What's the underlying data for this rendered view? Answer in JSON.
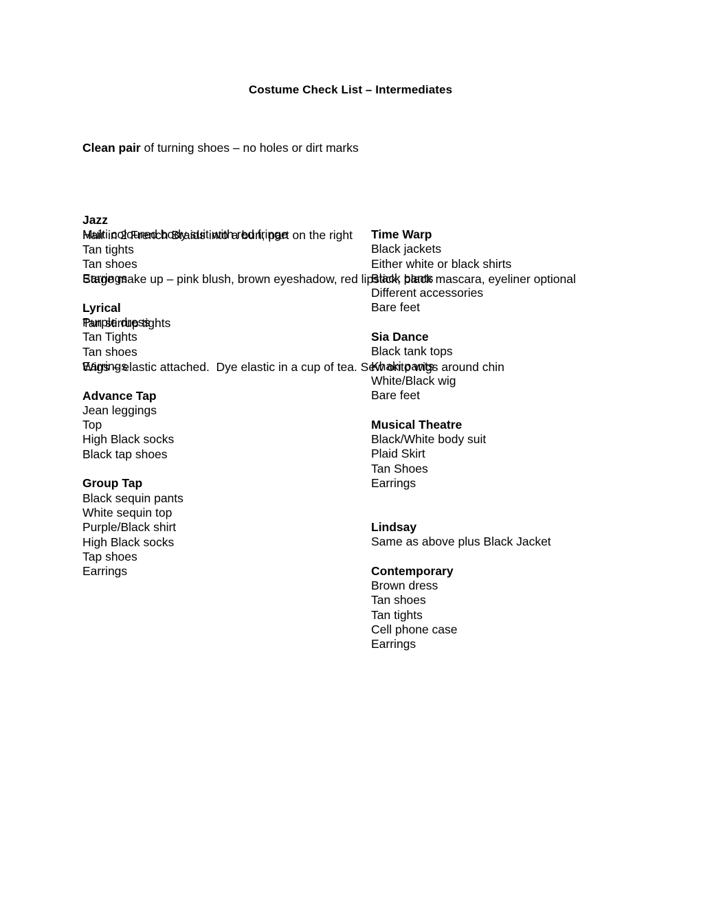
{
  "document": {
    "title": "Costume Check List – Intermediates",
    "intro": {
      "clean_pair_bold": "Clean pair",
      "clean_pair_rest": " of turning shoes – no holes or dirt marks",
      "lines": [
        "Hair in 2 French Braids into a bun, part on the right",
        "Stage make up – pink blush, brown eyeshadow, red lipstick, black mascara, eyeliner optional",
        "Tan stirrup tights",
        "Wigs – elastic attached.  Dye elastic in a cup of tea. Sew onto wigs around chin"
      ]
    },
    "left_column": [
      {
        "heading": "Jazz",
        "items": [
          "Multi coloured body suit with red fringe",
          "Tan tights",
          "Tan shoes",
          "Earrings"
        ]
      },
      {
        "heading": "Lyrical",
        "items": [
          "Purple dress",
          "Tan Tights",
          "Tan shoes",
          "Earrings"
        ]
      },
      {
        "heading": "Advance Tap",
        "items": [
          "Jean leggings",
          "Top",
          "High Black socks",
          "Black tap shoes"
        ]
      },
      {
        "heading": "Group Tap",
        "items": [
          "Black sequin pants",
          "White sequin top",
          "Purple/Black shirt",
          "High Black socks",
          "Tap shoes",
          "Earrings"
        ]
      }
    ],
    "right_column": [
      {
        "heading": "Time Warp",
        "items": [
          "Black jackets",
          "Either white or black shirts",
          "Black pants",
          "Different accessories",
          "Bare feet"
        ]
      },
      {
        "heading": "Sia Dance",
        "items": [
          "Black tank tops",
          "Khaki pants",
          "White/Black wig",
          "Bare feet"
        ]
      },
      {
        "heading": "Musical Theatre",
        "items": [
          "Black/White body suit",
          "Plaid Skirt",
          "Tan Shoes",
          "Earrings"
        ]
      },
      {
        "heading": "Lindsay",
        "extra_gap": true,
        "items": [
          "Same as above plus Black Jacket"
        ]
      },
      {
        "heading": "Contemporary",
        "items": [
          "Brown dress",
          "Tan shoes",
          "Tan tights",
          "Cell phone case",
          "Earrings"
        ]
      }
    ]
  }
}
